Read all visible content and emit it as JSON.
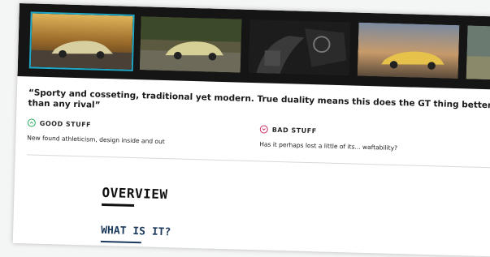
{
  "gallery": {
    "thumbnails": [
      {
        "label": "car-thumbnail-1",
        "active": true
      },
      {
        "label": "car-thumbnail-2",
        "active": false
      },
      {
        "label": "car-thumbnail-3",
        "active": false
      },
      {
        "label": "car-thumbnail-4",
        "active": false
      },
      {
        "label": "car-thumbnail-5",
        "active": false
      }
    ]
  },
  "review": {
    "quote": "“Sporty and cosseting, traditional yet modern. True duality means this does the GT thing better than any rival”"
  },
  "good": {
    "heading": "GOOD STUFF",
    "icon": "chevron-up-circle-icon",
    "text": "New found athleticism, design inside and out",
    "color": "#27ae60"
  },
  "bad": {
    "heading": "BAD STUFF",
    "icon": "chevron-down-circle-icon",
    "text": "Has it perhaps lost a little of its... waftability?",
    "color": "#d1306b"
  },
  "sections": {
    "overview": "OVERVIEW",
    "what_is_it": "WHAT IS IT?"
  },
  "colors": {
    "accent": "#1ea6c4",
    "heading_blue": "#1c3a5c"
  }
}
